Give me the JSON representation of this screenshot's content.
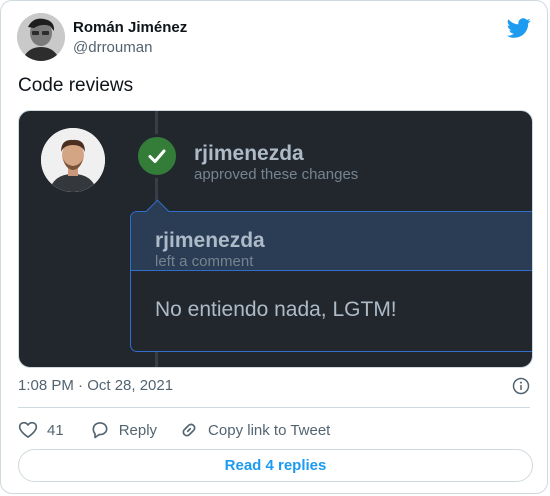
{
  "author": {
    "name": "Román Jiménez",
    "handle": "@drrouman"
  },
  "icons": {
    "brand": "twitter-bird-icon",
    "info": "info-icon",
    "like": "heart-icon",
    "reply": "reply-bubble-icon",
    "copy_link": "link-icon",
    "approved": "check-icon"
  },
  "tweet": {
    "text": "Code reviews",
    "timestamp": "1:08 PM · Oct 28, 2021"
  },
  "media": {
    "approval": {
      "user": "rjimenezda",
      "action": "approved these changes"
    },
    "comment": {
      "header_user": "rjimenezda",
      "header_action": "left a comment",
      "body": "No entiendo nada, LGTM!"
    }
  },
  "actions": {
    "like_count": "41",
    "reply_label": "Reply",
    "copy_label": "Copy link to Tweet"
  },
  "footer": {
    "read_replies": "Read 4 replies"
  },
  "colors": {
    "twitter_blue": "#1d9bf0",
    "approved_green": "#347d39",
    "github_dark_bg": "#22272e",
    "comment_border_blue": "#316dca"
  }
}
